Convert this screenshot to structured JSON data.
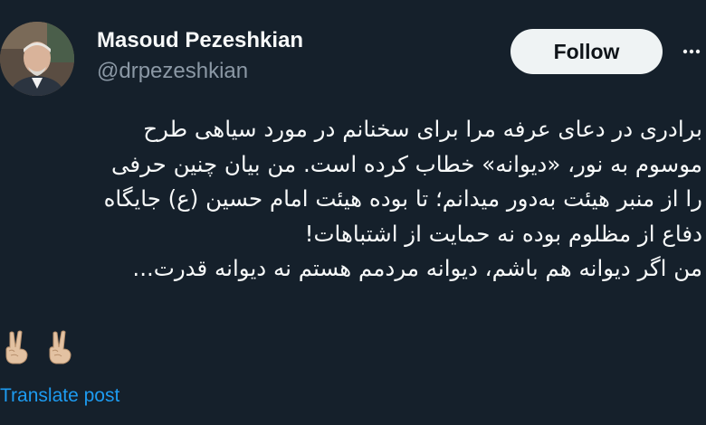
{
  "author": {
    "display_name": "Masoud Pezeshkian",
    "handle": "@drpezeshkian"
  },
  "follow_button": {
    "label": "Follow"
  },
  "more_menu": {
    "icon": "more-horizontal-icon"
  },
  "post": {
    "lines": [
      "برادری در دعای عرفه مرا برای سخنانم در مورد سیاهی طرح",
      "موسوم به نور، «دیوانه» خطاب کرده است. من بیان چنین حرفی",
      "را از منبر هیئت به‌دور میدانم؛ تا بوده هیئت امام حسین (ع) جایگاه",
      "دفاع از مظلوم بوده نه حمایت از اشتباهات!",
      "من اگر دیوانه هم باشم، دیوانه مردمم هستم نه دیوانه قدرت..."
    ],
    "emojis": [
      "victory-hand-icon",
      "victory-hand-icon"
    ]
  },
  "translate": {
    "label": "Translate post"
  },
  "colors": {
    "background": "#15202b",
    "primary_text": "#f7f9f9",
    "secondary_text": "#8b98a5",
    "link": "#1d9bf0",
    "button_bg": "#eff3f4",
    "button_text": "#0f1419"
  }
}
